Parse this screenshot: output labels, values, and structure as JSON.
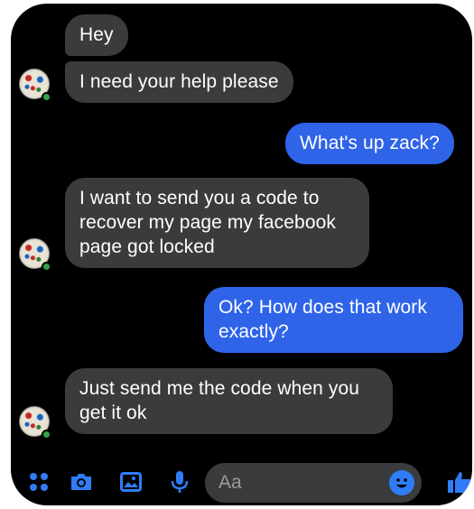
{
  "conversation": {
    "messages": [
      {
        "sender": "them",
        "text": "Hey"
      },
      {
        "sender": "them",
        "text": "I need your help please"
      },
      {
        "sender": "me",
        "text": "What's up zack?"
      },
      {
        "sender": "them",
        "text": "I want to send you a code to recover my page my facebook page got locked"
      },
      {
        "sender": "me",
        "text": "Ok?  How does that work exactly?"
      },
      {
        "sender": "them",
        "text": "Just send me the code when you get it ok"
      }
    ]
  },
  "composer": {
    "placeholder": "Aa",
    "icons": [
      "apps-icon",
      "camera-icon",
      "gallery-icon",
      "microphone-icon",
      "emoji-icon",
      "thumbs-up-icon"
    ]
  },
  "colors": {
    "background": "#000000",
    "incoming_bubble": "#3a3b3c",
    "outgoing_bubble": "#2f64e9",
    "accent": "#2f7df6",
    "online": "#31a24c"
  }
}
